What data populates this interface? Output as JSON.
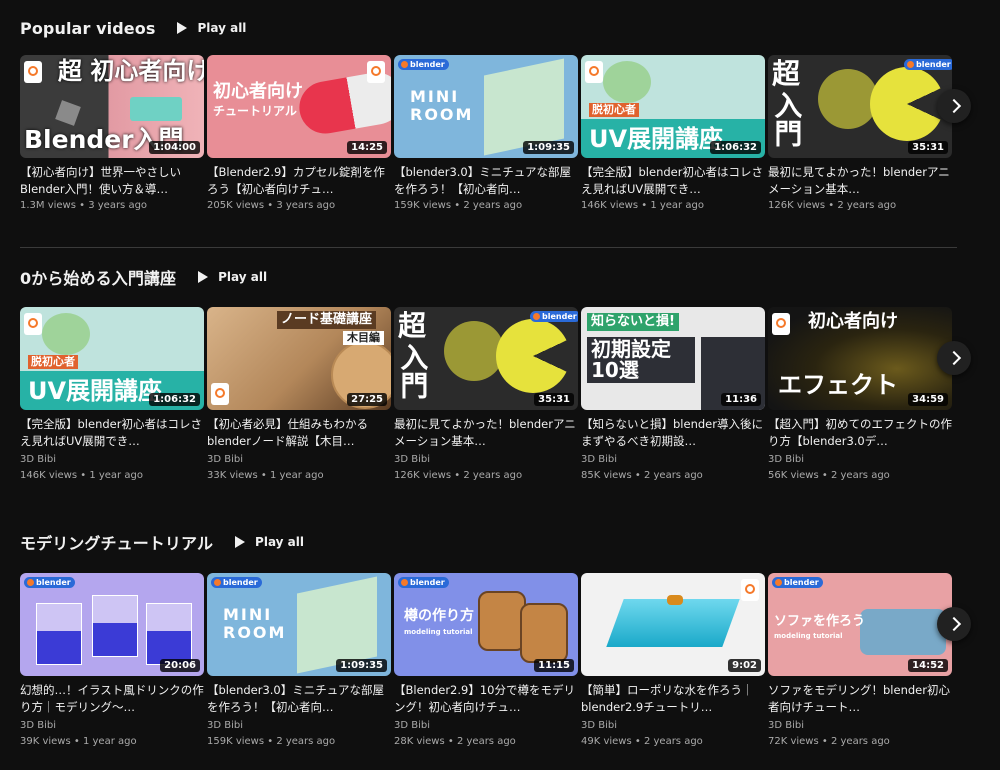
{
  "shelves": [
    {
      "title": "Popular videos",
      "play_all": "Play all",
      "videos": [
        {
          "thumb_text": "超 初心者向け",
          "thumb_text2": "Blender入門",
          "duration": "1:04:00",
          "title": "【初心者向け】世界一やさしいBlender入門！使い方＆導…",
          "channel": "",
          "meta": "1.3M views • 3 years ago"
        },
        {
          "thumb_text": "初心者向け",
          "thumb_text2": "チュートリアル",
          "duration": "14:25",
          "title": "【Blender2.9】カプセル錠剤を作ろう【初心者向けチュ…",
          "channel": "",
          "meta": "205K views • 3 years ago"
        },
        {
          "thumb_text": "MINI",
          "thumb_text2": "ROOM",
          "duration": "1:09:35",
          "title": "【blender3.0】ミニチュアな部屋を作ろう！【初心者向…",
          "channel": "",
          "meta": "159K views • 2 years ago"
        },
        {
          "thumb_text": "脱初心者",
          "thumb_text2": "UV展開講座",
          "duration": "1:06:32",
          "title": "【完全版】blender初心者はコレさえ見ればUV展開でき…",
          "channel": "",
          "meta": "146K views • 1 year ago"
        },
        {
          "thumb_text": "超",
          "thumb_text2": "入門",
          "duration": "35:31",
          "title": "最初に見てよかった！blenderアニメーション基本…",
          "channel": "",
          "meta": "126K views • 2 years ago"
        }
      ]
    },
    {
      "title": "0から始める入門講座",
      "play_all": "Play all",
      "videos": [
        {
          "thumb_text": "脱初心者",
          "thumb_text2": "UV展開講座",
          "duration": "1:06:32",
          "title": "【完全版】blender初心者はコレさえ見ればUV展開でき…",
          "channel": "3D Bibi",
          "meta": "146K views • 1 year ago"
        },
        {
          "thumb_text": "ノード基礎講座",
          "thumb_text2": "木目編",
          "duration": "27:25",
          "title": "【初心者必見】仕組みもわかるblenderノード解説【木目…",
          "channel": "3D Bibi",
          "meta": "33K views • 1 year ago"
        },
        {
          "thumb_text": "超",
          "thumb_text2": "入門",
          "duration": "35:31",
          "title": "最初に見てよかった！blenderアニメーション基本…",
          "channel": "3D Bibi",
          "meta": "126K views • 2 years ago"
        },
        {
          "thumb_text": "知らないと損!",
          "thumb_text2": "初期設定 10選",
          "duration": "11:36",
          "title": "【知らないと損】blender導入後にまずやるべき初期設…",
          "channel": "3D Bibi",
          "meta": "85K views • 2 years ago"
        },
        {
          "thumb_text": "初心者向け",
          "thumb_text2": "エフェクト",
          "duration": "34:59",
          "title": "【超入門】初めてのエフェクトの作り方【blender3.0デ…",
          "channel": "3D Bibi",
          "meta": "56K views • 2 years ago"
        }
      ]
    },
    {
      "title": "モデリングチュートリアル",
      "play_all": "Play all",
      "videos": [
        {
          "thumb_text": "",
          "thumb_text2": "",
          "duration": "20:06",
          "title": "幻想的…！イラスト風ドリンクの作り方｜モデリング〜…",
          "channel": "3D Bibi",
          "meta": "39K views • 1 year ago"
        },
        {
          "thumb_text": "MINI",
          "thumb_text2": "ROOM",
          "duration": "1:09:35",
          "title": "【blender3.0】ミニチュアな部屋を作ろう！【初心者向…",
          "channel": "3D Bibi",
          "meta": "159K views • 2 years ago"
        },
        {
          "thumb_text": "樽の作り方",
          "thumb_text2": "modeling tutorial",
          "duration": "11:15",
          "title": "【Blender2.9】10分で樽をモデリング！初心者向けチュ…",
          "channel": "3D Bibi",
          "meta": "28K views • 2 years ago"
        },
        {
          "thumb_text": "",
          "thumb_text2": "",
          "duration": "9:02",
          "title": "【簡単】ローポリな水を作ろう｜blender2.9チュートリ…",
          "channel": "3D Bibi",
          "meta": "49K views • 2 years ago"
        },
        {
          "thumb_text": "ソファを作ろう",
          "thumb_text2": "modeling tutorial",
          "duration": "14:52",
          "title": "ソファをモデリング！blender初心者向けチュート…",
          "channel": "3D Bibi",
          "meta": "72K views • 2 years ago"
        }
      ]
    }
  ],
  "icons": {
    "play": "play-icon",
    "next": "chevron-right-icon",
    "logo": "blender-logo"
  },
  "colors": {
    "background": "#0f0f0f",
    "text": "#f1f1f1",
    "secondary": "#aaaaaa"
  },
  "logo_text": "blender"
}
